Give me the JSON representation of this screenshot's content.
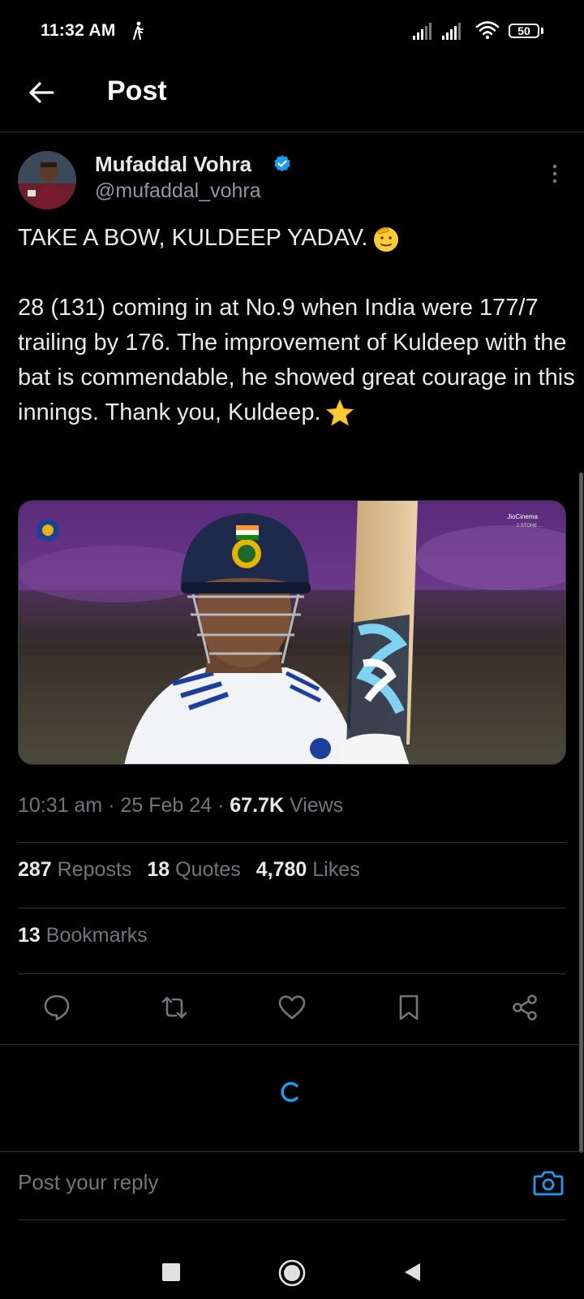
{
  "status_bar": {
    "time": "11:32 AM",
    "battery": "50"
  },
  "header": {
    "title": "Post"
  },
  "author": {
    "name": "Mufaddal Vohra",
    "handle": "@mufaddal_vohra"
  },
  "tweet": {
    "line1": "TAKE A BOW, KULDEEP YADAV.",
    "line1_emoji": "saluting-face",
    "body": "28 (131) coming in at No.9 when India were 177/7 trailing by 176. The improvement of Kuldeep with the bat is commendable, he showed great courage in this innings. Thank you, Kuldeep.",
    "body_emoji": "star"
  },
  "media": {
    "watermark_line1": "JioCinema",
    "watermark_line2": "2 STONE ..."
  },
  "meta": {
    "time": "10:31 am",
    "sep1": " · ",
    "date": "25 Feb 24",
    "sep2": " · ",
    "views_count": "67.7K",
    "views_label": " Views"
  },
  "stats": {
    "reposts_count": "287",
    "reposts_label": "Reposts",
    "quotes_count": "18",
    "quotes_label": "Quotes",
    "likes_count": "4,780",
    "likes_label": "Likes",
    "bookmarks_count": "13",
    "bookmarks_label": "Bookmarks"
  },
  "reply": {
    "placeholder": "Post your reply"
  },
  "colors": {
    "background": "#000000",
    "text_primary": "#e7e9ea",
    "text_secondary": "#71767b",
    "accent": "#1d9bf0",
    "divider": "#2f3336"
  },
  "icons": {
    "back": "back-arrow-icon",
    "verified": "verified-badge-icon",
    "more": "more-vertical-icon",
    "reply": "reply-icon",
    "repost": "repost-icon",
    "like": "heart-icon",
    "bookmark": "bookmark-icon",
    "share": "share-icon",
    "camera": "camera-icon"
  }
}
